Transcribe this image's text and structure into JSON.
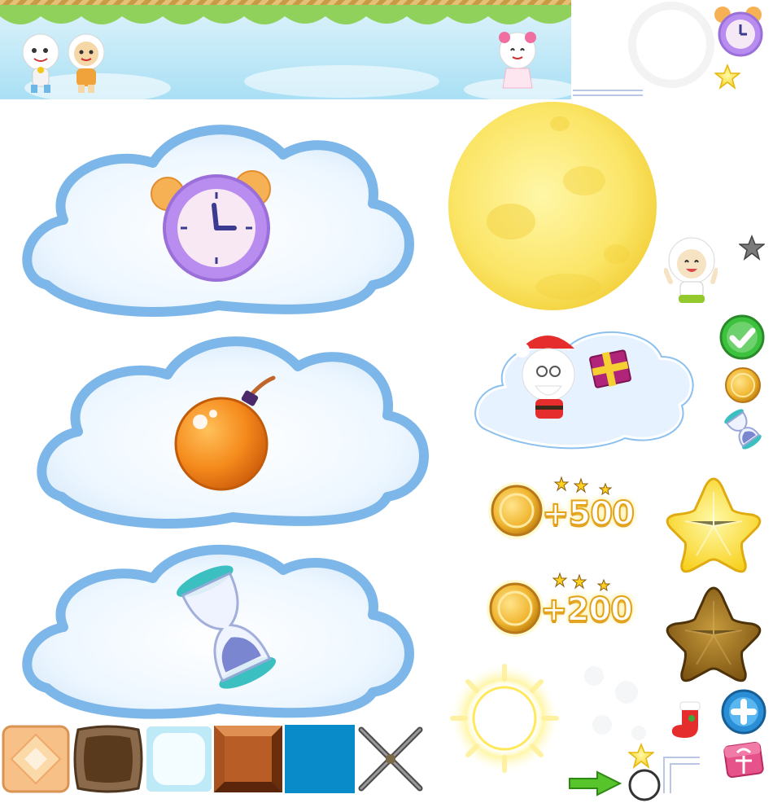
{
  "sprite_sheet": {
    "top_banner": {
      "characters": [
        "pleasant-goat",
        "sparky-goat",
        "pretty-goat"
      ],
      "leaf_color": "#8fd15a",
      "sky_color": "#bfe8f7"
    },
    "powerup_clouds": [
      {
        "item": "alarm-clock",
        "item_color": "#b98cf0"
      },
      {
        "item": "bomb",
        "item_color": "#f58a1c"
      },
      {
        "item": "hourglass",
        "item_color": "#3bbfc0"
      }
    ],
    "moon_color": "#fbe566",
    "santa_cloud": {
      "character": "santa-goat",
      "gift_color": "#b0257a"
    },
    "coin_rewards": [
      {
        "amount_label": "+500"
      },
      {
        "amount_label": "+200"
      }
    ],
    "stars": {
      "gold": "#ffe64a",
      "bronze": "#a47a22"
    },
    "buttons": {
      "confirm_color": "#3cc23c",
      "add_color": "#2a8fd6"
    },
    "tiles": [
      {
        "name": "peach-tile",
        "color": "#f7c087"
      },
      {
        "name": "chocolate-tile",
        "color": "#5a3a1c"
      },
      {
        "name": "ice-tile",
        "color": "#d9f5fb"
      },
      {
        "name": "copper-tile",
        "color": "#b85d25"
      },
      {
        "name": "blue-tile",
        "color": "#0a8bc9"
      },
      {
        "name": "cross-sticks",
        "color": "#6e6e6e"
      }
    ],
    "arrow_color": "#58c42c"
  }
}
